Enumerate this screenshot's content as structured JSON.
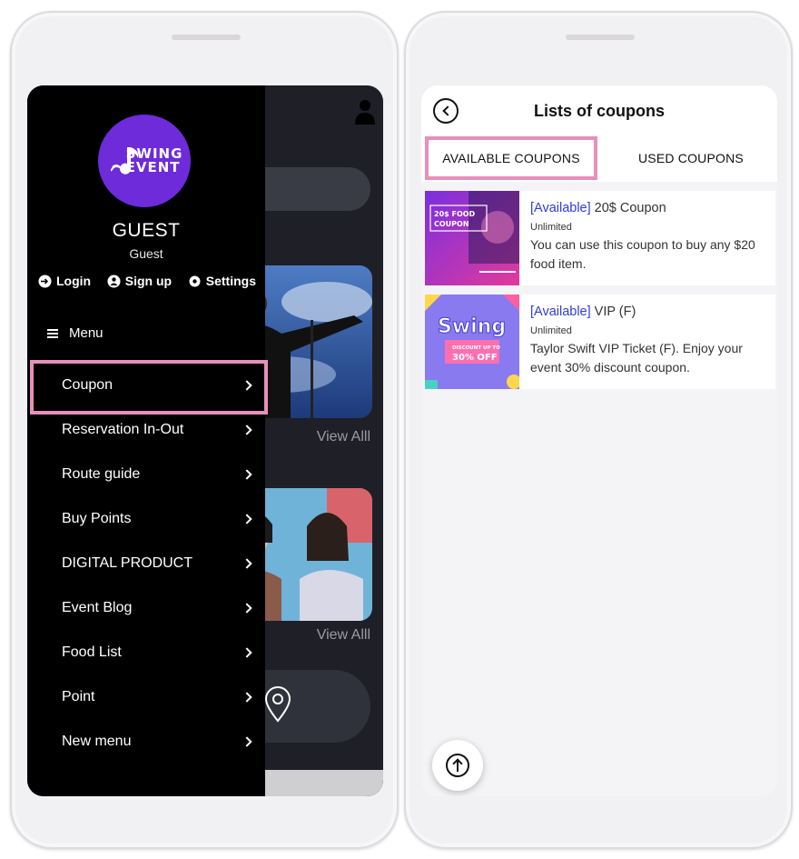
{
  "left_phone": {
    "drawer": {
      "logo_text_1": "SWING",
      "logo_text_2": "EVENT",
      "user_name": "GUEST",
      "user_role": "Guest",
      "actions": [
        {
          "label": "Login",
          "icon": "login-icon"
        },
        {
          "label": "Sign up",
          "icon": "signup-icon"
        },
        {
          "label": "Settings",
          "icon": "gear-icon"
        }
      ],
      "menu_label": "Menu",
      "items": [
        {
          "label": "Coupon"
        },
        {
          "label": "Reservation In-Out"
        },
        {
          "label": "Route guide"
        },
        {
          "label": "Buy Points"
        },
        {
          "label": "DIGITAL PRODUCT"
        },
        {
          "label": "Event Blog"
        },
        {
          "label": "Food List"
        },
        {
          "label": "Point"
        },
        {
          "label": "New menu"
        }
      ]
    },
    "background": {
      "view_all_1": "View Alll",
      "view_all_2": "View Alll"
    }
  },
  "right_phone": {
    "title": "Lists of coupons",
    "tabs": {
      "available": "AVAILABLE COUPONS",
      "used": "USED COUPONS"
    },
    "coupons": [
      {
        "status": "[Available]",
        "name": " 20$ Coupon",
        "limit": "Unlimited",
        "description": "You can use this coupon to buy any $20 food item.",
        "thumb_text": "20$ FOOD COUPON"
      },
      {
        "status": "[Available]",
        "name": " VIP (F)",
        "limit": "Unlimited",
        "description": "Taylor Swift VIP Ticket (F). Enjoy your event 30% discount coupon.",
        "thumb_text": "Swing",
        "thumb_sub": "DISCOUNT UP TO",
        "thumb_badge": "30% OFF"
      }
    ]
  },
  "colors": {
    "highlight": "#e88fbc",
    "logo_bg": "#6d2bd9",
    "available_text": "#2f3dd8"
  }
}
